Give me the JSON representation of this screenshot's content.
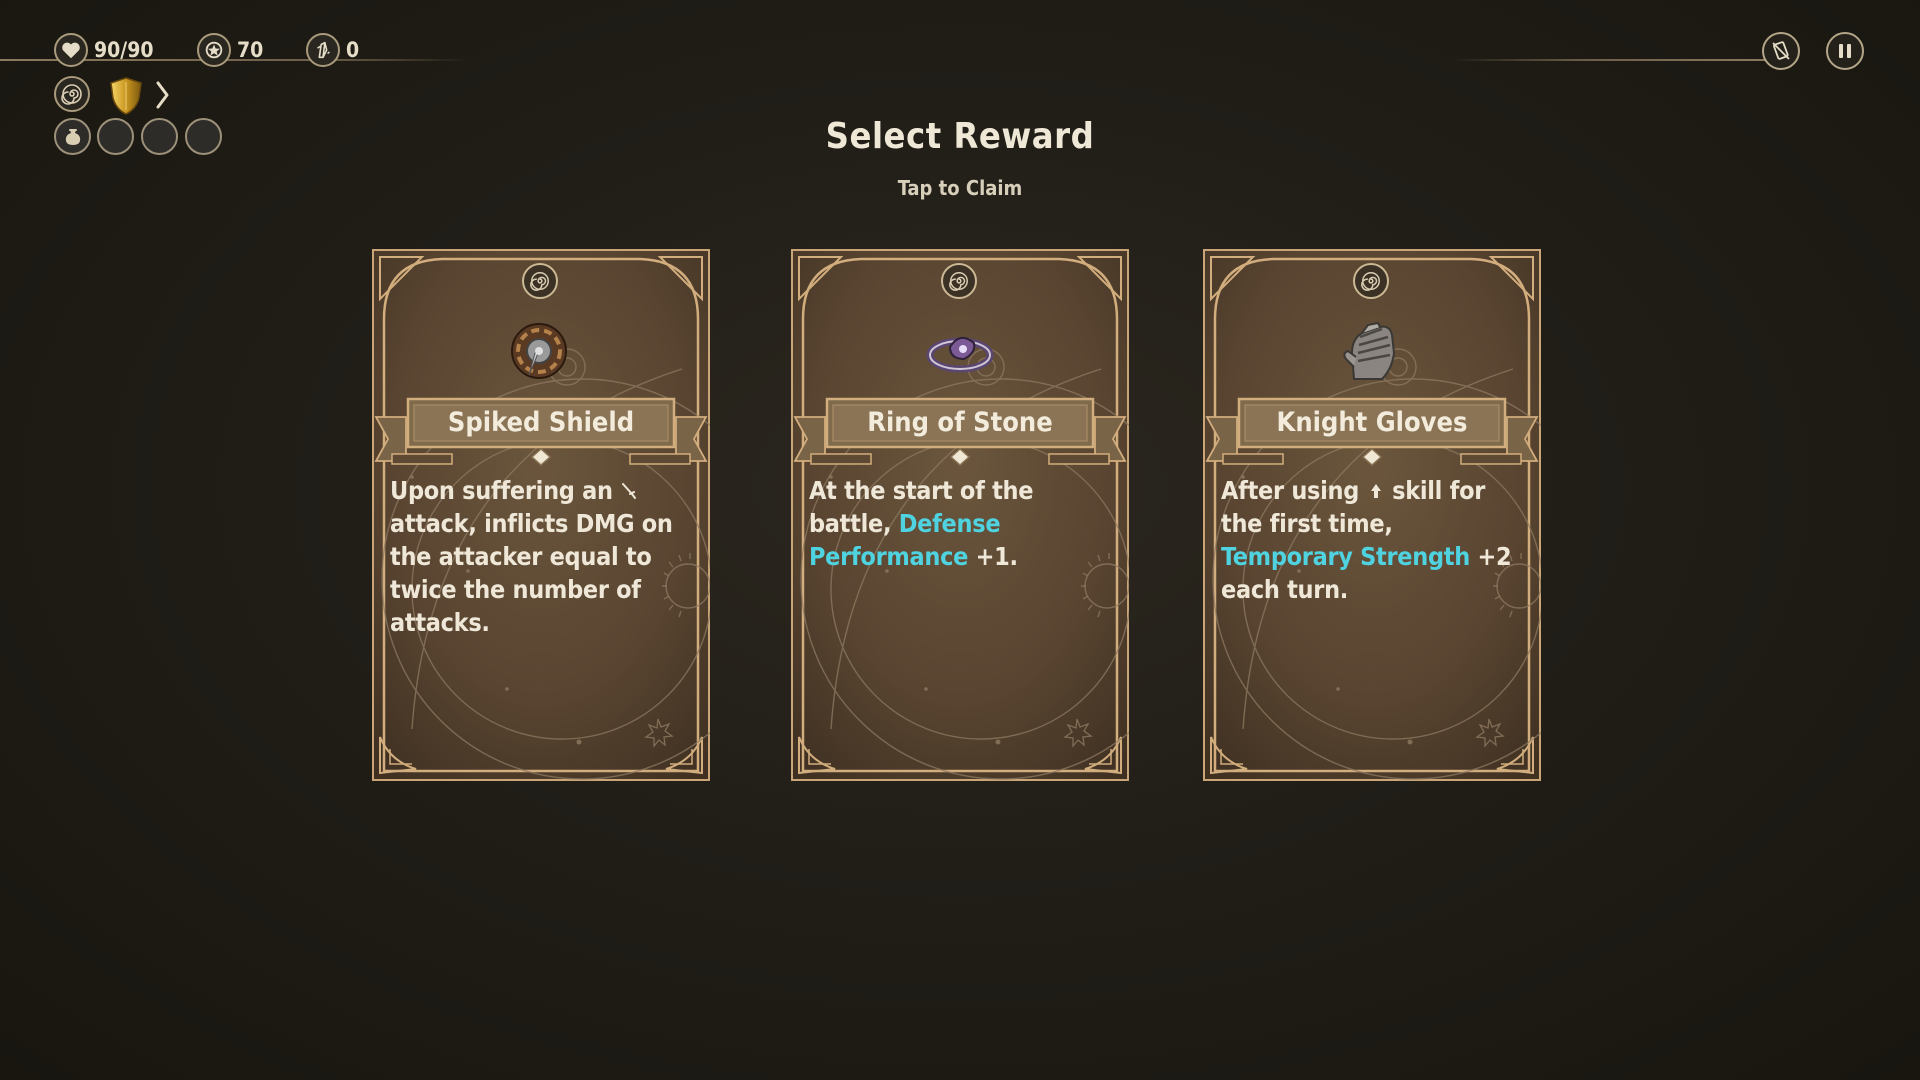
{
  "hud": {
    "health": "90/90",
    "gold": "70",
    "shards": "0"
  },
  "title": "Select Reward",
  "subtitle": "Tap to Claim",
  "cards": [
    {
      "name": "Spiked Shield",
      "icon": "spiked-shield-icon",
      "desc_a": "Upon suffering an",
      "desc_b": "attack, inflicts DMG on the attacker equal to twice the number of attacks."
    },
    {
      "name": "Ring of Stone",
      "icon": "stone-ring-icon",
      "desc_a": "At the start of the battle,",
      "desc_hl": "Defense Performance",
      "desc_b": "+1."
    },
    {
      "name": "Knight Gloves",
      "icon": "knight-gloves-icon",
      "desc_a": "After using",
      "desc_b": "skill for the first time,",
      "desc_hl": "Temporary Strength",
      "desc_c": "+2 each turn."
    }
  ],
  "colors": {
    "highlight": "#4fd3e0",
    "frame": "#c9a577",
    "card_bg": "#5a4632"
  }
}
